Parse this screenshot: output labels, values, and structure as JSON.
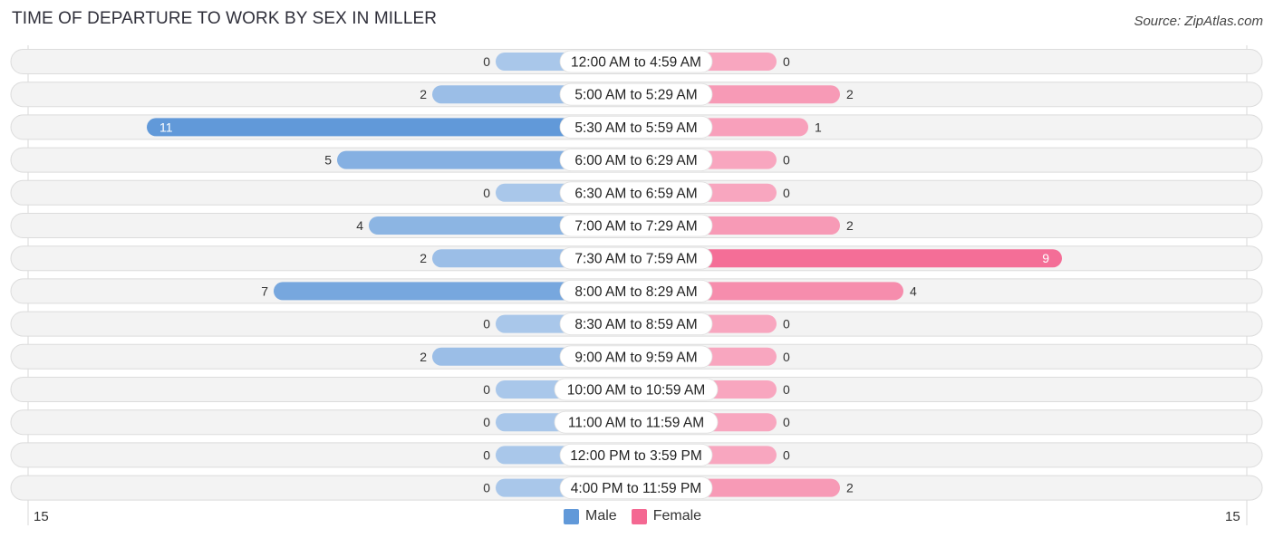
{
  "title": "TIME OF DEPARTURE TO WORK BY SEX IN MILLER",
  "source": "Source: ZipAtlas.com",
  "colors": {
    "male_strong": "#6199d9",
    "male_light": "#a9c7ea",
    "female_strong": "#f46892",
    "female_light": "#f8a6bf",
    "row_bg": "#f2f2f2"
  },
  "chart_data": {
    "type": "bar",
    "orientation": "horizontal-diverging",
    "title": "TIME OF DEPARTURE TO WORK BY SEX IN MILLER",
    "categories": [
      "12:00 AM to 4:59 AM",
      "5:00 AM to 5:29 AM",
      "5:30 AM to 5:59 AM",
      "6:00 AM to 6:29 AM",
      "6:30 AM to 6:59 AM",
      "7:00 AM to 7:29 AM",
      "7:30 AM to 7:59 AM",
      "8:00 AM to 8:29 AM",
      "8:30 AM to 8:59 AM",
      "9:00 AM to 9:59 AM",
      "10:00 AM to 10:59 AM",
      "11:00 AM to 11:59 AM",
      "12:00 PM to 3:59 PM",
      "4:00 PM to 11:59 PM"
    ],
    "series": [
      {
        "name": "Male",
        "values": [
          0,
          2,
          11,
          5,
          0,
          4,
          2,
          7,
          0,
          2,
          0,
          0,
          0,
          0
        ]
      },
      {
        "name": "Female",
        "values": [
          0,
          2,
          1,
          0,
          0,
          2,
          9,
          4,
          0,
          0,
          0,
          0,
          0,
          2
        ]
      }
    ],
    "axis": {
      "left_max_label": "15",
      "right_max_label": "15",
      "range": [
        0,
        15
      ]
    },
    "legend": {
      "position": "bottom-center",
      "entries": [
        "Male",
        "Female"
      ]
    },
    "grid": false
  },
  "axis_labels": {
    "left": "15",
    "right": "15"
  },
  "legend": {
    "male": "Male",
    "female": "Female"
  }
}
